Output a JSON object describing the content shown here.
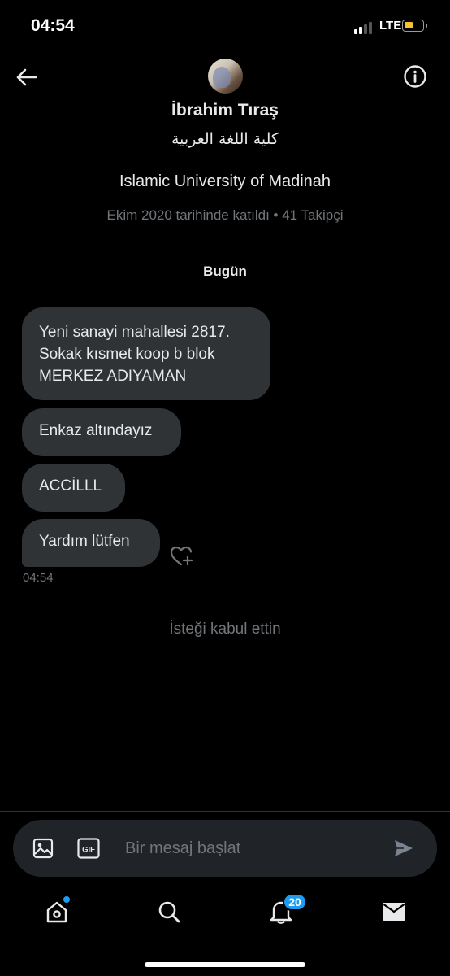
{
  "status_bar": {
    "time": "04:54",
    "network": "LTE",
    "signal_bars_active": 2,
    "signal_bars_total": 4,
    "battery_color": "#f4c430"
  },
  "header": {
    "back_icon": "arrow-left-icon",
    "info_icon": "info-circle-icon"
  },
  "profile": {
    "name": "İbrahim Tıraş",
    "handle": "كلية اللغة العربية",
    "bio": "Islamic University of Madinah",
    "meta": "Ekim 2020 tarihinde katıldı • 41 Takipçi"
  },
  "conversation": {
    "day_label": "Bugün",
    "messages": [
      {
        "lines": [
          "Yeni sanayi mahallesi 2817.",
          "Sokak kısmet koop b blok",
          "MERKEZ ADIYAMAN"
        ]
      },
      {
        "text": "Enkaz altındayız"
      },
      {
        "text": "ACCİLLL"
      },
      {
        "text": "Yardım lütfen"
      }
    ],
    "last_message_time": "04:54",
    "system_note": "İsteği kabul ettin",
    "reaction_icon": "heart-plus-icon"
  },
  "composer": {
    "placeholder": "Bir mesaj başlat",
    "media_icon": "image-icon",
    "gif_label": "GIF",
    "send_icon": "send-icon"
  },
  "bottom_nav": {
    "items": [
      "home-icon",
      "search-icon",
      "bell-icon",
      "mail-icon"
    ],
    "notifications_badge": "20",
    "accent": "#1d9bf0"
  }
}
